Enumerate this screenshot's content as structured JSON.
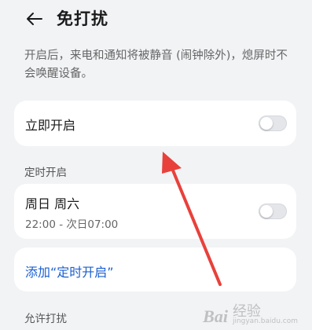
{
  "header": {
    "back_icon": "arrow-left-icon",
    "title": "免打扰"
  },
  "description": "开启后，来电和通知将被静音 (闹钟除外)，熄屏时不会唤醒设备。",
  "immediate": {
    "label": "立即开启",
    "toggle_on": false
  },
  "scheduled": {
    "section_title": "定时开启",
    "item": {
      "days": "周日 周六",
      "time": "22:00 - 次日07:00",
      "toggle_on": false
    },
    "add_label": "添加“定时开启”"
  },
  "allow": {
    "section_title": "允许打扰"
  },
  "colors": {
    "accent": "#1a5fd0",
    "annotation": "#e8413b"
  },
  "watermark": {
    "logo": "Bai",
    "text": "经验",
    "url": "jingyan.baidu.com"
  }
}
